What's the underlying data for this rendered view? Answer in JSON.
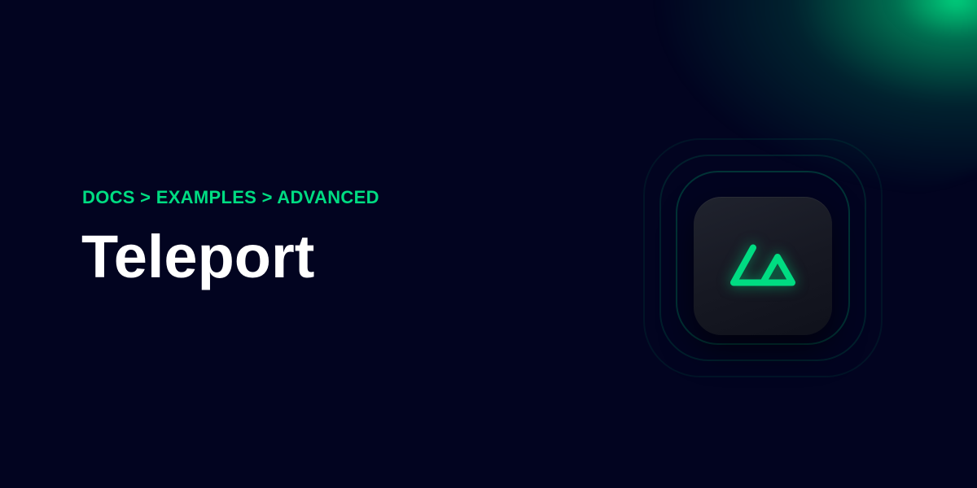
{
  "breadcrumb": {
    "text": "DOCS > EXAMPLES > ADVANCED"
  },
  "page": {
    "title": "Teleport"
  },
  "logo": {
    "icon": "nuxt-logo-icon"
  },
  "colors": {
    "background": "#020420",
    "accent": "#00dc82",
    "title": "#ffffff",
    "tile": "#1a1d28"
  }
}
